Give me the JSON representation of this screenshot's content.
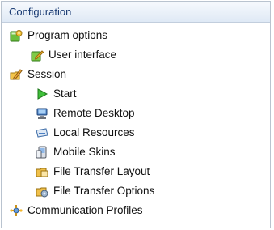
{
  "panel": {
    "title": "Configuration"
  },
  "tree": {
    "program_options": {
      "label": "Program options",
      "children": {
        "user_interface": {
          "label": "User interface"
        }
      }
    },
    "session": {
      "label": "Session",
      "children": {
        "start": {
          "label": "Start"
        },
        "remote_desktop": {
          "label": "Remote Desktop"
        },
        "local_resources": {
          "label": "Local Resources"
        },
        "mobile_skins": {
          "label": "Mobile Skins"
        },
        "file_transfer_layout": {
          "label": "File Transfer Layout"
        },
        "file_transfer_options": {
          "label": "File Transfer Options"
        }
      }
    },
    "communication_profiles": {
      "label": "Communication Profiles"
    }
  },
  "icons": {
    "program_options": "book-gear-icon",
    "user_interface": "pencil-book-icon",
    "session": "pencil-folder-icon",
    "start": "play-icon",
    "remote_desktop": "monitor-icon",
    "local_resources": "drive-icon",
    "mobile_skins": "mobile-device-icon",
    "file_transfer_layout": "file-layout-icon",
    "file_transfer_options": "file-options-icon",
    "communication_profiles": "network-icon"
  }
}
